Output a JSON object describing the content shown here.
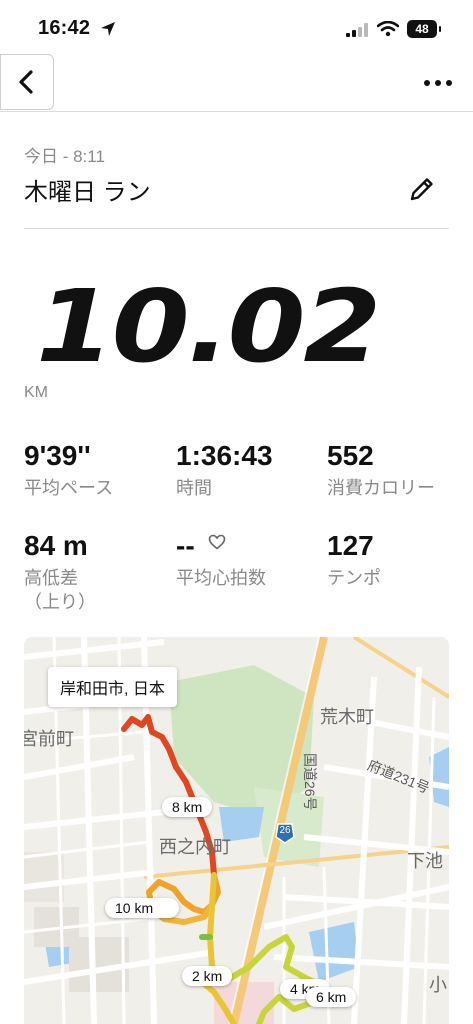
{
  "status_bar": {
    "time": "16:42",
    "battery": "48"
  },
  "nav": {
    "back_icon": "chevron-left-icon",
    "more_icon": "ellipsis-icon"
  },
  "header": {
    "date": "今日 - 8:11",
    "title": "木曜日 ラン",
    "edit_icon": "pencil-icon"
  },
  "distance": {
    "value": "10.02",
    "unit": "KM"
  },
  "stats": [
    {
      "value": "9'39''",
      "label": "平均ペース"
    },
    {
      "value": "1:36:43",
      "label": "時間"
    },
    {
      "value": "552",
      "label": "消費カロリー"
    },
    {
      "value": "84 m",
      "label": "高低差\n（上り）"
    },
    {
      "value": "--",
      "label": "平均心拍数",
      "icon": "heart-icon"
    },
    {
      "value": "127",
      "label": "テンポ"
    }
  ],
  "map": {
    "location": "岸和田市, 日本",
    "places": [
      "宮前町",
      "荒木町",
      "西之内町",
      "下池",
      "小"
    ],
    "roads": [
      "府道231号",
      "国道26号"
    ],
    "route_shield": "26",
    "km_markers": [
      "8 km",
      "10 km",
      "2 km",
      "4 km",
      "6 km"
    ],
    "colors": {
      "water": "#a6cef0",
      "park": "#cfe5c2",
      "route_fast": "#e0461f",
      "route_mid": "#f0a22a",
      "route_slow": "#c6d63a"
    }
  }
}
